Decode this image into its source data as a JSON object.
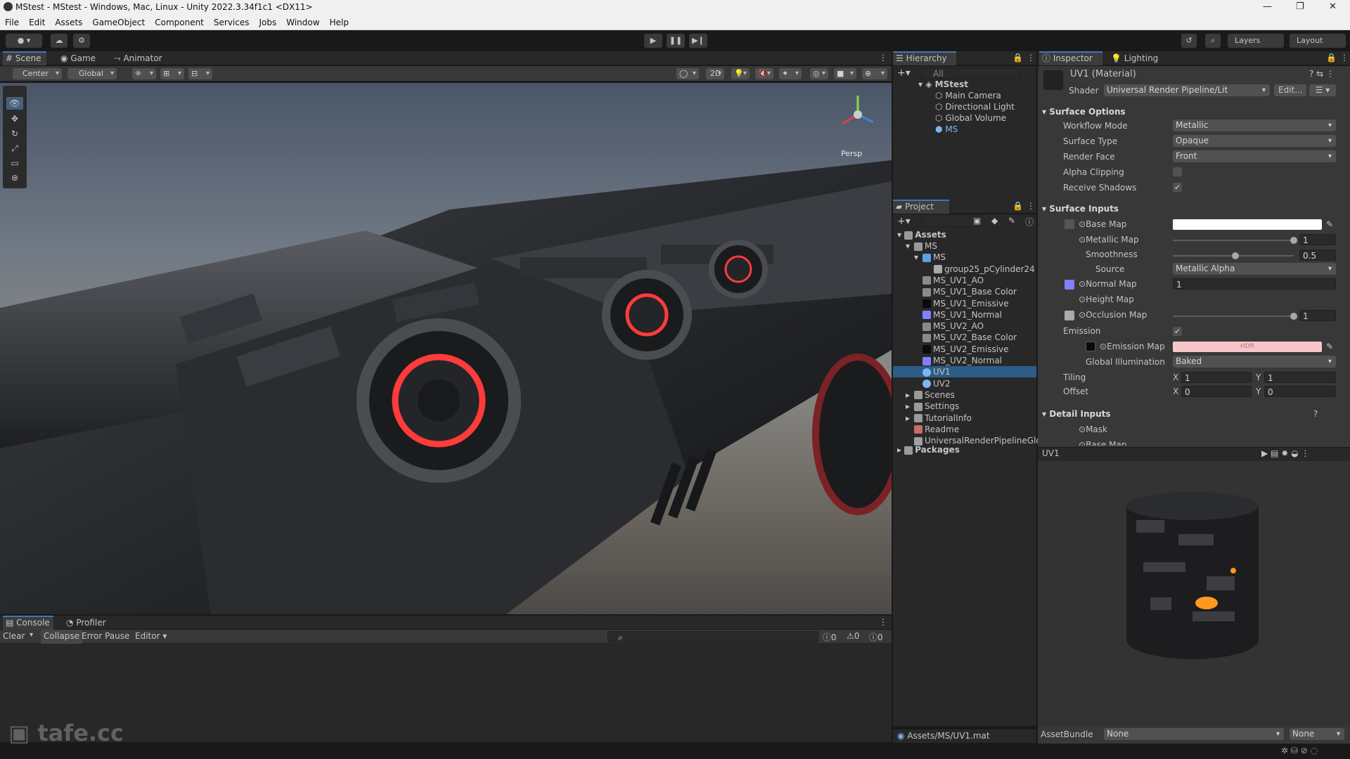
{
  "window": {
    "title": "MStest - MStest - Windows, Mac, Linux - Unity 2022.3.34f1c1 <DX11>"
  },
  "menu": [
    "File",
    "Edit",
    "Assets",
    "GameObject",
    "Component",
    "Services",
    "Jobs",
    "Window",
    "Help"
  ],
  "toolbar": {
    "layers": "Layers",
    "layout": "Layout"
  },
  "scene_tabs": [
    {
      "label": "Scene",
      "icon": "grid-icon"
    },
    {
      "label": "Game",
      "icon": "gamepad-icon"
    },
    {
      "label": "Animator",
      "icon": "animator-icon"
    }
  ],
  "scene_toolbar": {
    "pivot": "Center",
    "space": "Global",
    "mode_2d": "2D",
    "persp_label": "Persp"
  },
  "hierarchy": {
    "title": "Hierarchy",
    "search_placeholder": "All",
    "scene": "MStest",
    "items": [
      "Main Camera",
      "Directional Light",
      "Global Volume",
      "MS"
    ]
  },
  "project": {
    "title": "Project",
    "root": "Assets",
    "items": [
      {
        "label": "MS",
        "depth": 1,
        "kind": "folder"
      },
      {
        "label": "MS",
        "depth": 2,
        "kind": "prefab"
      },
      {
        "label": "group25_pCylinder24",
        "depth": 3,
        "kind": "mesh"
      },
      {
        "label": "MS_UV1_AO",
        "depth": 2,
        "kind": "texture"
      },
      {
        "label": "MS_UV1_Base Color",
        "depth": 2,
        "kind": "texture"
      },
      {
        "label": "MS_UV1_Emissive",
        "depth": 2,
        "kind": "texture-dark"
      },
      {
        "label": "MS_UV1_Normal",
        "depth": 2,
        "kind": "texture-normal"
      },
      {
        "label": "MS_UV2_AO",
        "depth": 2,
        "kind": "texture"
      },
      {
        "label": "MS_UV2_Base Color",
        "depth": 2,
        "kind": "texture"
      },
      {
        "label": "MS_UV2_Emissive",
        "depth": 2,
        "kind": "texture-dark"
      },
      {
        "label": "MS_UV2_Normal",
        "depth": 2,
        "kind": "texture-normal"
      },
      {
        "label": "UV1",
        "depth": 2,
        "kind": "material"
      },
      {
        "label": "UV2",
        "depth": 2,
        "kind": "material"
      },
      {
        "label": "Scenes",
        "depth": 1,
        "kind": "folder"
      },
      {
        "label": "Settings",
        "depth": 1,
        "kind": "folder"
      },
      {
        "label": "TutorialInfo",
        "depth": 1,
        "kind": "folder"
      },
      {
        "label": "Readme",
        "depth": 1,
        "kind": "readme"
      },
      {
        "label": "UniversalRenderPipelineGlo",
        "depth": 1,
        "kind": "asset"
      }
    ],
    "packages": "Packages",
    "footer_path": "Assets/MS/UV1.mat"
  },
  "inspector": {
    "tabs": [
      "Inspector",
      "Lighting"
    ],
    "material_name": "UV1 (Material)",
    "shader_label": "Shader",
    "shader_value": "Universal Render Pipeline/Lit",
    "edit_button": "Edit...",
    "surface_options": {
      "title": "Surface Options",
      "workflow_mode": {
        "label": "Workflow Mode",
        "value": "Metallic"
      },
      "surface_type": {
        "label": "Surface Type",
        "value": "Opaque"
      },
      "render_face": {
        "label": "Render Face",
        "value": "Front"
      },
      "alpha_clipping": {
        "label": "Alpha Clipping",
        "checked": false
      },
      "receive_shadows": {
        "label": "Receive Shadows",
        "checked": true
      }
    },
    "surface_inputs": {
      "title": "Surface Inputs",
      "base_map": "Base Map",
      "metallic_map": {
        "label": "Metallic Map",
        "value": "1",
        "fraction": 1.0
      },
      "smoothness": {
        "label": "Smoothness",
        "value": "0.5",
        "fraction": 0.5
      },
      "source": {
        "label": "Source",
        "value": "Metallic Alpha"
      },
      "normal_map": {
        "label": "Normal Map",
        "value": "1"
      },
      "height_map": "Height Map",
      "occlusion_map": {
        "label": "Occlusion Map",
        "value": "1",
        "fraction": 1.0
      },
      "emission": {
        "label": "Emission",
        "checked": true
      },
      "emission_map": {
        "label": "Emission Map",
        "hdr": "HDR"
      },
      "global_illumination": {
        "label": "Global Illumination",
        "value": "Baked"
      },
      "tiling": {
        "label": "Tiling",
        "x": "1",
        "y": "1"
      },
      "offset": {
        "label": "Offset",
        "x": "0",
        "y": "0"
      }
    },
    "detail_inputs": {
      "title": "Detail Inputs",
      "mask": "Mask",
      "base_map": "Base Map"
    },
    "preview_title": "UV1",
    "asset_bundle": {
      "label": "AssetBundle",
      "value": "None",
      "variant": "None"
    }
  },
  "console": {
    "tabs": [
      "Console",
      "Profiler"
    ],
    "buttons": [
      "Clear",
      "Collapse",
      "Error Pause",
      "Editor"
    ],
    "counts": {
      "info": "0",
      "warn": "0",
      "error": "0"
    }
  },
  "watermark": "tafe.cc",
  "axis_labels": {
    "x": "X",
    "y": "Y"
  },
  "colors": {
    "accent": "#3a79bb",
    "selection": "#2c5d87",
    "emission": "#ff3b3b",
    "hdr_swatch": "#f7c6c8"
  }
}
